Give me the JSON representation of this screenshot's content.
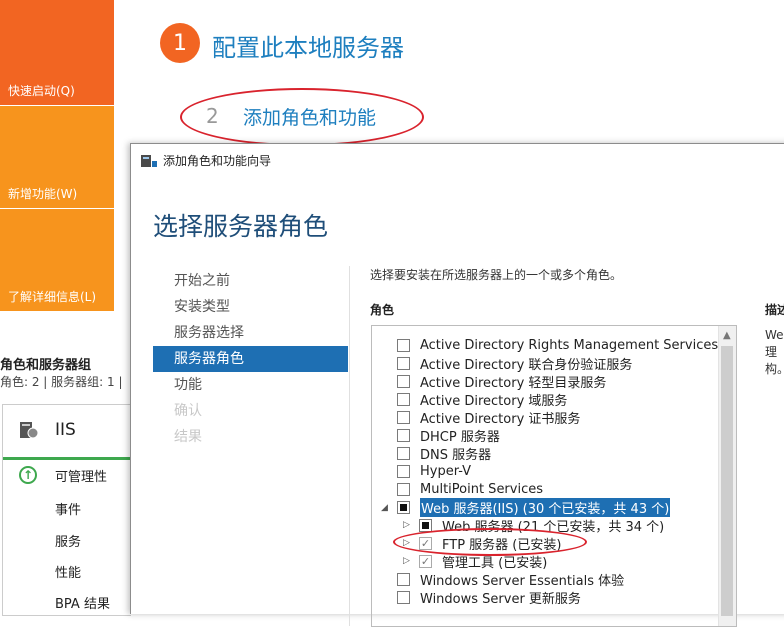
{
  "tiles": {
    "quick_start": "快速启动(Q)",
    "whats_new": "新增功能(W)",
    "learn_more": "了解详细信息(L)"
  },
  "steps": {
    "step1_number": "1",
    "step1_title": "配置此本地服务器",
    "step2_number": "2",
    "step2_title": "添加角色和功能"
  },
  "server_groups": {
    "title": "角色和服务器组",
    "subtitle": "角色: 2 | 服务器组: 1 |"
  },
  "iis_panel": {
    "name": "IIS",
    "items": [
      "可管理性",
      "事件",
      "服务",
      "性能",
      "BPA 结果"
    ]
  },
  "wizard": {
    "title": "添加角色和功能向导",
    "heading": "选择服务器角色",
    "nav": [
      "开始之前",
      "安装类型",
      "服务器选择",
      "服务器角色",
      "功能",
      "确认",
      "结果"
    ],
    "instruction": "选择要安装在所选服务器上的一个或多个角色。",
    "roles_label": "角色",
    "description_label": "描述",
    "description_lines": [
      "We",
      "理",
      "构。"
    ],
    "roles": [
      "Active Directory Rights Management Services",
      "Active Directory 联合身份验证服务",
      "Active Directory 轻型目录服务",
      "Active Directory 域服务",
      "Active Directory 证书服务",
      "DHCP 服务器",
      "DNS 服务器",
      "Hyper-V",
      "MultiPoint Services",
      "Web 服务器(IIS) (30 个已安装，共 43 个)",
      "Web 服务器 (21 个已安装，共 34 个)",
      "FTP 服务器 (已安装)",
      "管理工具 (已安装)",
      "Windows Server Essentials 体验",
      "Windows Server 更新服务"
    ]
  },
  "colors": {
    "orange_primary": "#f26522",
    "orange_secondary": "#f7941d",
    "accent_blue": "#1e6fb3",
    "title_blue": "#1e7fbf",
    "annotation_red": "#d9232d",
    "status_green": "#3ea84e"
  }
}
